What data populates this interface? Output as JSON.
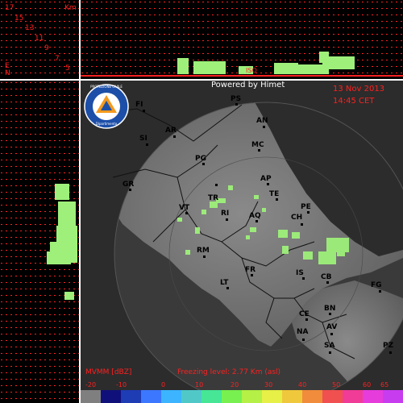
{
  "top_panel": {
    "unit_label": "Km",
    "height_ticks": [
      "17",
      "15",
      "13",
      "11",
      "9",
      "7",
      "5"
    ],
    "corner_labels": [
      "E",
      "N"
    ],
    "freezing_marker": "ISO"
  },
  "header": {
    "powered_by": "Powered by Himet",
    "date": "13 Nov 2013",
    "time": "14:45 CET"
  },
  "logo": {
    "text_top": "PROTEZIONE CIVILE",
    "text_bottom": "Dipartimento"
  },
  "cities": [
    "FI",
    "PS",
    "AN",
    "AR",
    "SI",
    "MC",
    "PG",
    "GR",
    "AP",
    "TE",
    "TR",
    "PE",
    "VT",
    "RI",
    "AQ",
    "CH",
    "RM",
    "FR",
    "IS",
    "CB",
    "FG",
    "LT",
    "CE",
    "BN",
    "NA",
    "AV",
    "SA",
    "PZ"
  ],
  "footer": {
    "product": "MVMM [dBZ]",
    "freezing_level": "Freezing level: 2.77 Km (asl)"
  },
  "colorbar": {
    "labels": [
      "-20",
      "-10",
      "0",
      "10",
      "20",
      "30",
      "40",
      "50",
      "60",
      "65"
    ],
    "colors": [
      "#7f7f7f",
      "#10107a",
      "#1e3cb4",
      "#3c78ff",
      "#3cb4ff",
      "#50c8c8",
      "#46e696",
      "#78f050",
      "#b4f046",
      "#e6f046",
      "#f0c83c",
      "#f08c3c",
      "#f05050",
      "#f03c96",
      "#e63cdc",
      "#c83cf0"
    ],
    "color_names": [
      "gray",
      "navy",
      "dark-blue",
      "blue",
      "sky",
      "cyan",
      "aqua-green",
      "green",
      "light-green",
      "yellow",
      "orange-yellow",
      "orange",
      "red",
      "pink",
      "magenta",
      "violet"
    ]
  },
  "colors": {
    "label_red": "#ff2020",
    "echo_green": "#9ef07a",
    "map_bg": "#2c2c2c"
  }
}
